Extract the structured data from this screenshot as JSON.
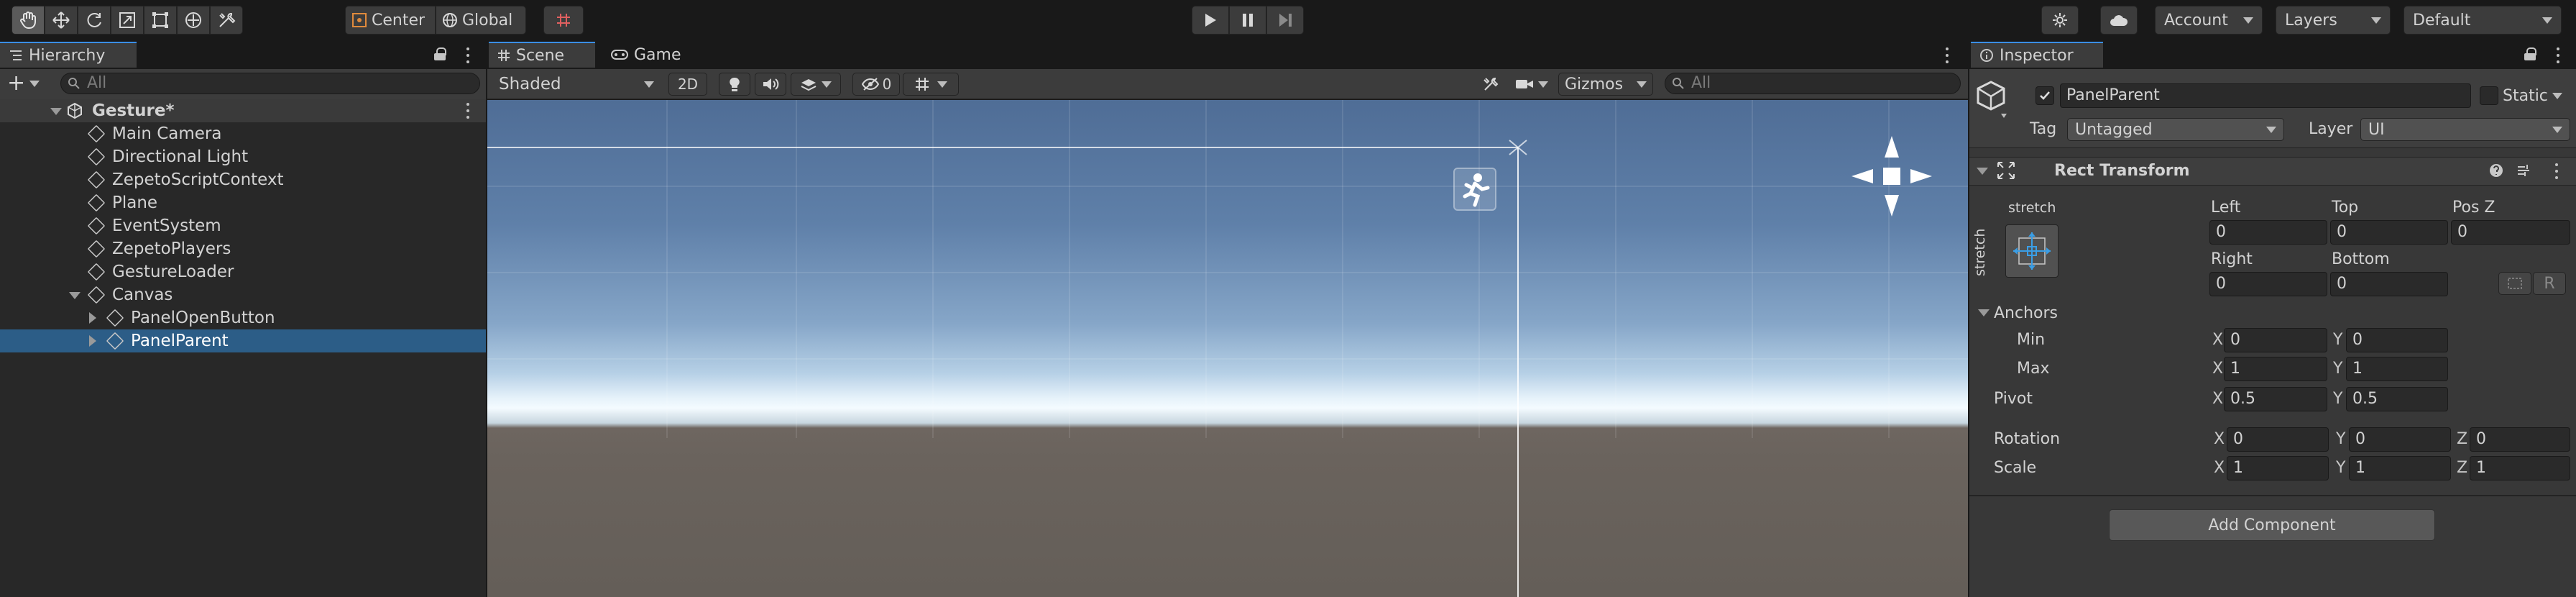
{
  "toolbar": {
    "tools": [
      {
        "name": "hand-tool",
        "icon": "hand-icon"
      },
      {
        "name": "move-tool",
        "icon": "move-icon"
      },
      {
        "name": "rotate-tool",
        "icon": "rotate-icon"
      },
      {
        "name": "scale-tool",
        "icon": "scale-icon"
      },
      {
        "name": "rect-tool",
        "icon": "rect-icon"
      },
      {
        "name": "transform-tool",
        "icon": "transform-icon"
      },
      {
        "name": "custom-tool",
        "icon": "wrench-icon"
      }
    ],
    "pivot_label": "Center",
    "space_label": "Global",
    "account_label": "Account",
    "layers_label": "Layers",
    "layout_label": "Default"
  },
  "hierarchy": {
    "tab_label": "Hierarchy",
    "search_placeholder": "All",
    "scene_name": "Gesture*",
    "items": [
      {
        "label": "Main Camera"
      },
      {
        "label": "Directional Light"
      },
      {
        "label": "ZepetoScriptContext"
      },
      {
        "label": "Plane"
      },
      {
        "label": "EventSystem"
      },
      {
        "label": "ZepetoPlayers"
      },
      {
        "label": "GestureLoader"
      },
      {
        "label": "Canvas"
      },
      {
        "label": "PanelOpenButton"
      },
      {
        "label": "PanelParent"
      }
    ]
  },
  "scene": {
    "tab_scene": "Scene",
    "tab_game": "Game",
    "draw_mode": "Shaded",
    "btn_2d": "2D",
    "hidden_count": "0",
    "gizmos_label": "Gizmos",
    "search_placeholder": "All"
  },
  "inspector": {
    "tab_label": "Inspector",
    "object_name": "PanelParent",
    "static_label": "Static",
    "tag_label": "Tag",
    "tag_value": "Untagged",
    "layer_label": "Layer",
    "layer_value": "UI",
    "component_title": "Rect Transform",
    "anchor_preset_top": "stretch",
    "anchor_preset_side": "stretch",
    "left_label": "Left",
    "left_value": "0",
    "top_label": "Top",
    "top_value": "0",
    "posz_label": "Pos Z",
    "posz_value": "0",
    "right_label": "Right",
    "right_value": "0",
    "bottom_label": "Bottom",
    "bottom_value": "0",
    "r_button": "R",
    "anchors_label": "Anchors",
    "min_label": "Min",
    "min_x": "0",
    "min_y": "0",
    "max_label": "Max",
    "max_x": "1",
    "max_y": "1",
    "pivot_label": "Pivot",
    "pivot_x": "0.5",
    "pivot_y": "0.5",
    "rotation_label": "Rotation",
    "rot_x": "0",
    "rot_y": "0",
    "rot_z": "0",
    "scale_label": "Scale",
    "scale_x": "1",
    "scale_y": "1",
    "scale_z": "1",
    "x_label": "X",
    "y_label": "Y",
    "z_label": "Z",
    "add_component": "Add Component"
  },
  "colors": {
    "selection": "#2c5d87",
    "panel": "#383838",
    "toolbar": "#191919",
    "accent_blue": "#3a8ee6"
  }
}
